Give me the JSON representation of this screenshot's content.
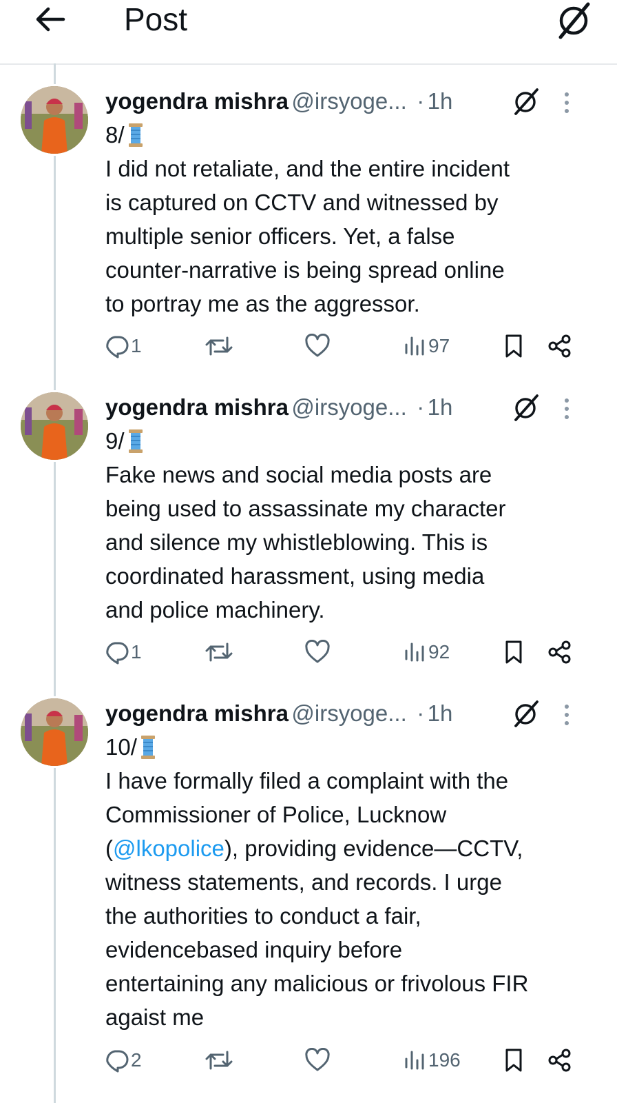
{
  "header": {
    "title": "Post"
  },
  "colors": {
    "text": "#0f1419",
    "secondary": "#536471",
    "mention": "#1d9bf0",
    "thread_line": "#cfd9de",
    "spool": "#5aa9e6"
  },
  "icons": {
    "back": "arrow-left-icon",
    "grok": "grok-slash-icon",
    "more": "vertical-dots-icon",
    "reply": "reply-icon",
    "repost": "repost-icon",
    "like": "heart-icon",
    "views": "views-bars-icon",
    "bookmark": "bookmark-icon",
    "share": "share-icon",
    "thread": "spool-emoji"
  },
  "tweets": [
    {
      "name": "yogendra mishra",
      "handle": "@irsyoge...",
      "separator": "·",
      "time": "1h",
      "number": "8/",
      "lines": [
        "I did not retaliate, and the entire incident",
        "is captured on CCTV and witnessed by",
        "multiple senior officers. Yet, a false",
        "counter-narrative is being spread online",
        "to portray me as the aggressor."
      ],
      "replies": "1",
      "reposts": "",
      "likes": "",
      "views": "97"
    },
    {
      "name": "yogendra mishra",
      "handle": "@irsyoge...",
      "separator": "·",
      "time": "1h",
      "number": "9/",
      "lines": [
        "Fake news and social media posts are",
        "being used to assassinate my character",
        "and silence my whistleblowing. This is",
        "coordinated harassment, using media",
        "and police machinery."
      ],
      "replies": "1",
      "reposts": "",
      "likes": "",
      "views": "92"
    },
    {
      "name": "yogendra mishra",
      "handle": "@irsyoge...",
      "separator": "·",
      "time": "1h",
      "number": "10/",
      "line1": "I have formally filed a complaint with the",
      "line2": "Commissioner of Police, Lucknow",
      "line3_open": "(",
      "mention": "@lkopolice",
      "line3_rest": "), providing evidence—CCTV,",
      "lines_after": [
        "witness statements, and records. I urge",
        "the authorities to conduct a fair,",
        "evidencebased inquiry before",
        "entertaining any malicious or frivolous FIR",
        "agaist me"
      ],
      "replies": "2",
      "reposts": "",
      "likes": "",
      "views": "196"
    }
  ]
}
